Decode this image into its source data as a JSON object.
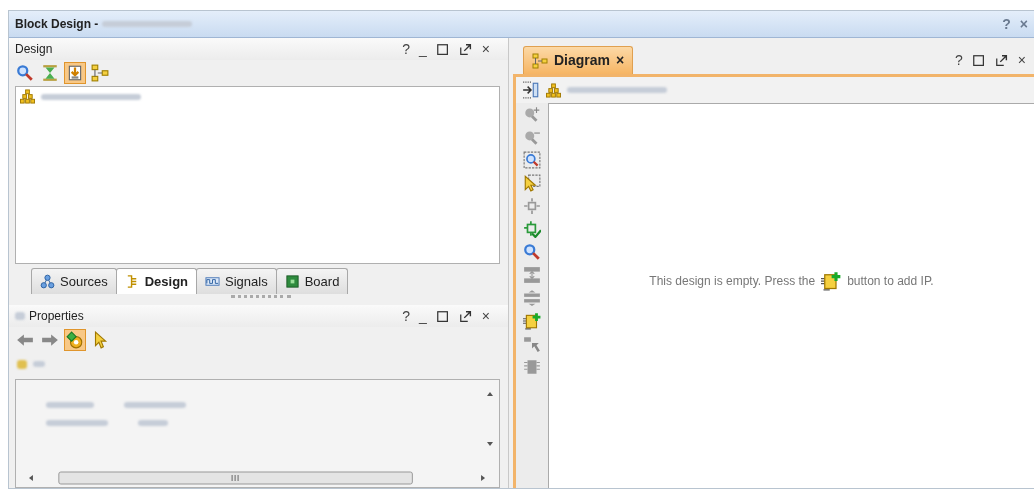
{
  "window": {
    "title": "Block Design -",
    "help": "?",
    "close": "×"
  },
  "design_panel": {
    "title": "Design",
    "help": "?",
    "minimize": "_",
    "close": "×",
    "toolbar": [
      {
        "kind": "search",
        "selected": false
      },
      {
        "kind": "collapse",
        "selected": false
      },
      {
        "kind": "hierarchy",
        "selected": true
      },
      {
        "kind": "tree",
        "selected": false
      }
    ]
  },
  "left_tabs": [
    {
      "kind": "sources",
      "label": "Sources",
      "selected": false
    },
    {
      "kind": "design",
      "label": "Design",
      "selected": true
    },
    {
      "kind": "signals",
      "label": "Signals",
      "selected": false
    },
    {
      "kind": "board",
      "label": "Board",
      "selected": false
    }
  ],
  "properties_panel": {
    "title": "Properties",
    "help": "?",
    "minimize": "_",
    "close": "×",
    "toolbar": [
      {
        "kind": "back",
        "selected": false
      },
      {
        "kind": "forward",
        "selected": false
      },
      {
        "kind": "settings",
        "selected": true
      },
      {
        "kind": "pointer",
        "selected": false
      }
    ]
  },
  "diagram_panel": {
    "tab": {
      "label": "Diagram",
      "close": "×",
      "selected": true
    },
    "help": "?",
    "close": "×",
    "toolbar": [
      {
        "kind": "collapse-panel"
      },
      {
        "kind": "zoom-in"
      },
      {
        "kind": "zoom-out"
      },
      {
        "kind": "zoom-fit"
      },
      {
        "kind": "select-area"
      },
      {
        "kind": "fit-view"
      },
      {
        "kind": "validate"
      },
      {
        "kind": "search"
      },
      {
        "kind": "collapse-all"
      },
      {
        "kind": "expand-all"
      },
      {
        "kind": "add-ip"
      },
      {
        "kind": "pin"
      },
      {
        "kind": "chip"
      }
    ],
    "message_before": "This design is empty. Press the",
    "message_after": "button to add IP."
  }
}
